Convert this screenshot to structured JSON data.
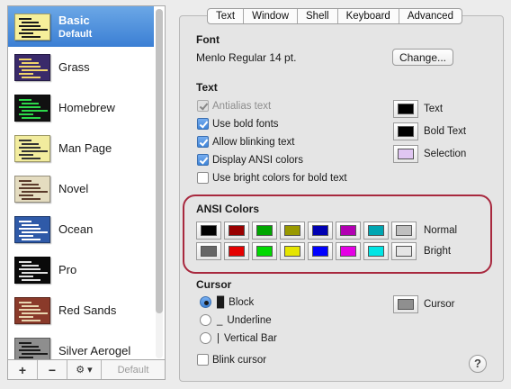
{
  "profiles": [
    {
      "name": "Basic",
      "sub": "Default",
      "selected": true,
      "thumb_bg": "#f6ef9a",
      "thumb_fg": "#1a1a1a"
    },
    {
      "name": "Grass",
      "sub": "",
      "selected": false,
      "thumb_bg": "#3a2a6a",
      "thumb_fg": "#f0d36a"
    },
    {
      "name": "Homebrew",
      "sub": "",
      "selected": false,
      "thumb_bg": "#111111",
      "thumb_fg": "#2cd84a"
    },
    {
      "name": "Man Page",
      "sub": "",
      "selected": false,
      "thumb_bg": "#f2ec9e",
      "thumb_fg": "#333333"
    },
    {
      "name": "Novel",
      "sub": "",
      "selected": false,
      "thumb_bg": "#e4dcc0",
      "thumb_fg": "#5a3a2a"
    },
    {
      "name": "Ocean",
      "sub": "",
      "selected": false,
      "thumb_bg": "#2f5aa8",
      "thumb_fg": "#ffffff"
    },
    {
      "name": "Pro",
      "sub": "",
      "selected": false,
      "thumb_bg": "#0a0a0a",
      "thumb_fg": "#e0e0e0"
    },
    {
      "name": "Red Sands",
      "sub": "",
      "selected": false,
      "thumb_bg": "#8a3a2a",
      "thumb_fg": "#e8d6b0"
    },
    {
      "name": "Silver Aerogel",
      "sub": "",
      "selected": false,
      "thumb_bg": "#8e8e8e",
      "thumb_fg": "#1a1a1a"
    }
  ],
  "sidebar_toolbar": {
    "add": "+",
    "remove": "−",
    "gear": "⚙ ▾",
    "default": "Default"
  },
  "tabs": [
    {
      "label": "Text",
      "active": true
    },
    {
      "label": "Window",
      "active": false
    },
    {
      "label": "Shell",
      "active": false
    },
    {
      "label": "Keyboard",
      "active": false
    },
    {
      "label": "Advanced",
      "active": false
    }
  ],
  "font": {
    "title": "Font",
    "value": "Menlo Regular 14 pt.",
    "change_button": "Change..."
  },
  "text_section": {
    "title": "Text",
    "options": [
      {
        "label": "Antialias text",
        "checked": true,
        "disabled": true
      },
      {
        "label": "Use bold fonts",
        "checked": true,
        "disabled": false
      },
      {
        "label": "Allow blinking text",
        "checked": true,
        "disabled": false
      },
      {
        "label": "Display ANSI colors",
        "checked": true,
        "disabled": false
      },
      {
        "label": "Use bright colors for bold text",
        "checked": false,
        "disabled": false
      }
    ],
    "colors": [
      {
        "label": "Text",
        "color": "#000000"
      },
      {
        "label": "Bold Text",
        "color": "#000000"
      },
      {
        "label": "Selection",
        "color": "#e0c6f2"
      }
    ]
  },
  "ansi": {
    "title": "ANSI Colors",
    "normal_label": "Normal",
    "bright_label": "Bright",
    "normal": [
      "#000000",
      "#990000",
      "#00a600",
      "#999900",
      "#0000b2",
      "#b200b2",
      "#00a6b2",
      "#bfbfbf"
    ],
    "bright": [
      "#666666",
      "#e50000",
      "#00d900",
      "#e5e500",
      "#0000ff",
      "#e500e5",
      "#00e5e5",
      "#e5e5e5"
    ]
  },
  "cursor": {
    "title": "Cursor",
    "options": [
      {
        "glyph": "█",
        "label": "Block",
        "selected": true
      },
      {
        "glyph": "_",
        "label": "Underline",
        "selected": false
      },
      {
        "glyph": "|",
        "label": "Vertical Bar",
        "selected": false
      }
    ],
    "color_label": "Cursor",
    "color": "#8f8f8f",
    "blink_label": "Blink cursor",
    "blink_checked": false
  },
  "help_label": "?"
}
